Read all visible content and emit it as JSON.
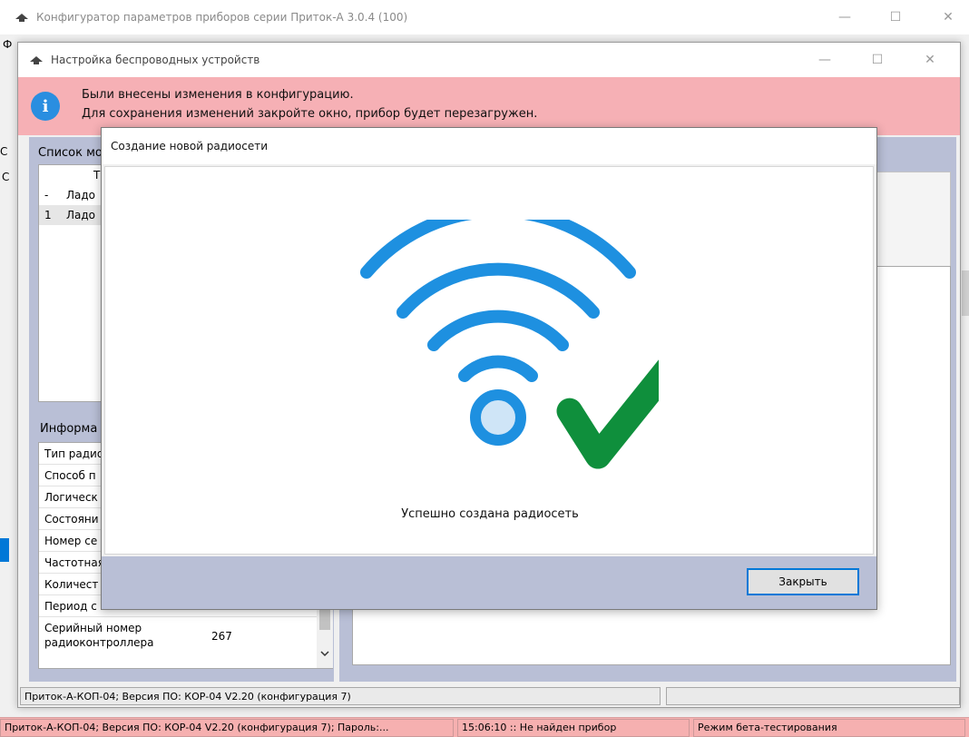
{
  "main_window": {
    "title": "Конфигуратор параметров приборов серии Приток-А  3.0.4 (100)",
    "minimize": "—",
    "maximize": "☐",
    "close": "✕",
    "edge_labels": [
      "Ф",
      "С",
      "С"
    ]
  },
  "status_bar": {
    "device": "Приток-А-КОП-04; Версия ПО: КОР-04 V2.20 (конфигурация 7); Пароль:...",
    "time_status": "15:06:10 :: Не найден прибор",
    "mode": "Режим бета-тестирования"
  },
  "wireless_dialog": {
    "title": "Настройка беспроводных устройств",
    "minimize": "—",
    "maximize": "☐",
    "close": "✕",
    "notice": {
      "line1": "Были внесены изменения в конфигурацию.",
      "line2": "Для сохранения изменений закройте окно, прибор будет перезагружен.",
      "icon_letter": "i"
    },
    "module_list": {
      "header": "Список мо",
      "column_header": "Т",
      "rows": [
        {
          "num": "-",
          "name": "Ладо"
        },
        {
          "num": "1",
          "name": "Ладо"
        }
      ]
    },
    "info_panel": {
      "header": "Информа",
      "rows": [
        "Тип радио",
        "Способ п",
        "Логическ",
        "Состояни",
        "Номер се",
        "Частотная",
        "Количест",
        "Период с"
      ],
      "serial_label": "Серийный номер радиоконтроллера",
      "serial_value": "267"
    },
    "status": "Приток-А-КОП-04; Версия ПО: КОР-04 V2.20 (конфигурация 7)"
  },
  "create_modal": {
    "title": "Создание новой радиосети",
    "message": "Успешно создана радиосеть",
    "close_label": "Закрыть",
    "colors": {
      "wifi": "#1e90e0",
      "wifi_dot_fill": "#cfe5f7",
      "check": "#0f8f3c",
      "footer": "#b9bfd6"
    }
  }
}
